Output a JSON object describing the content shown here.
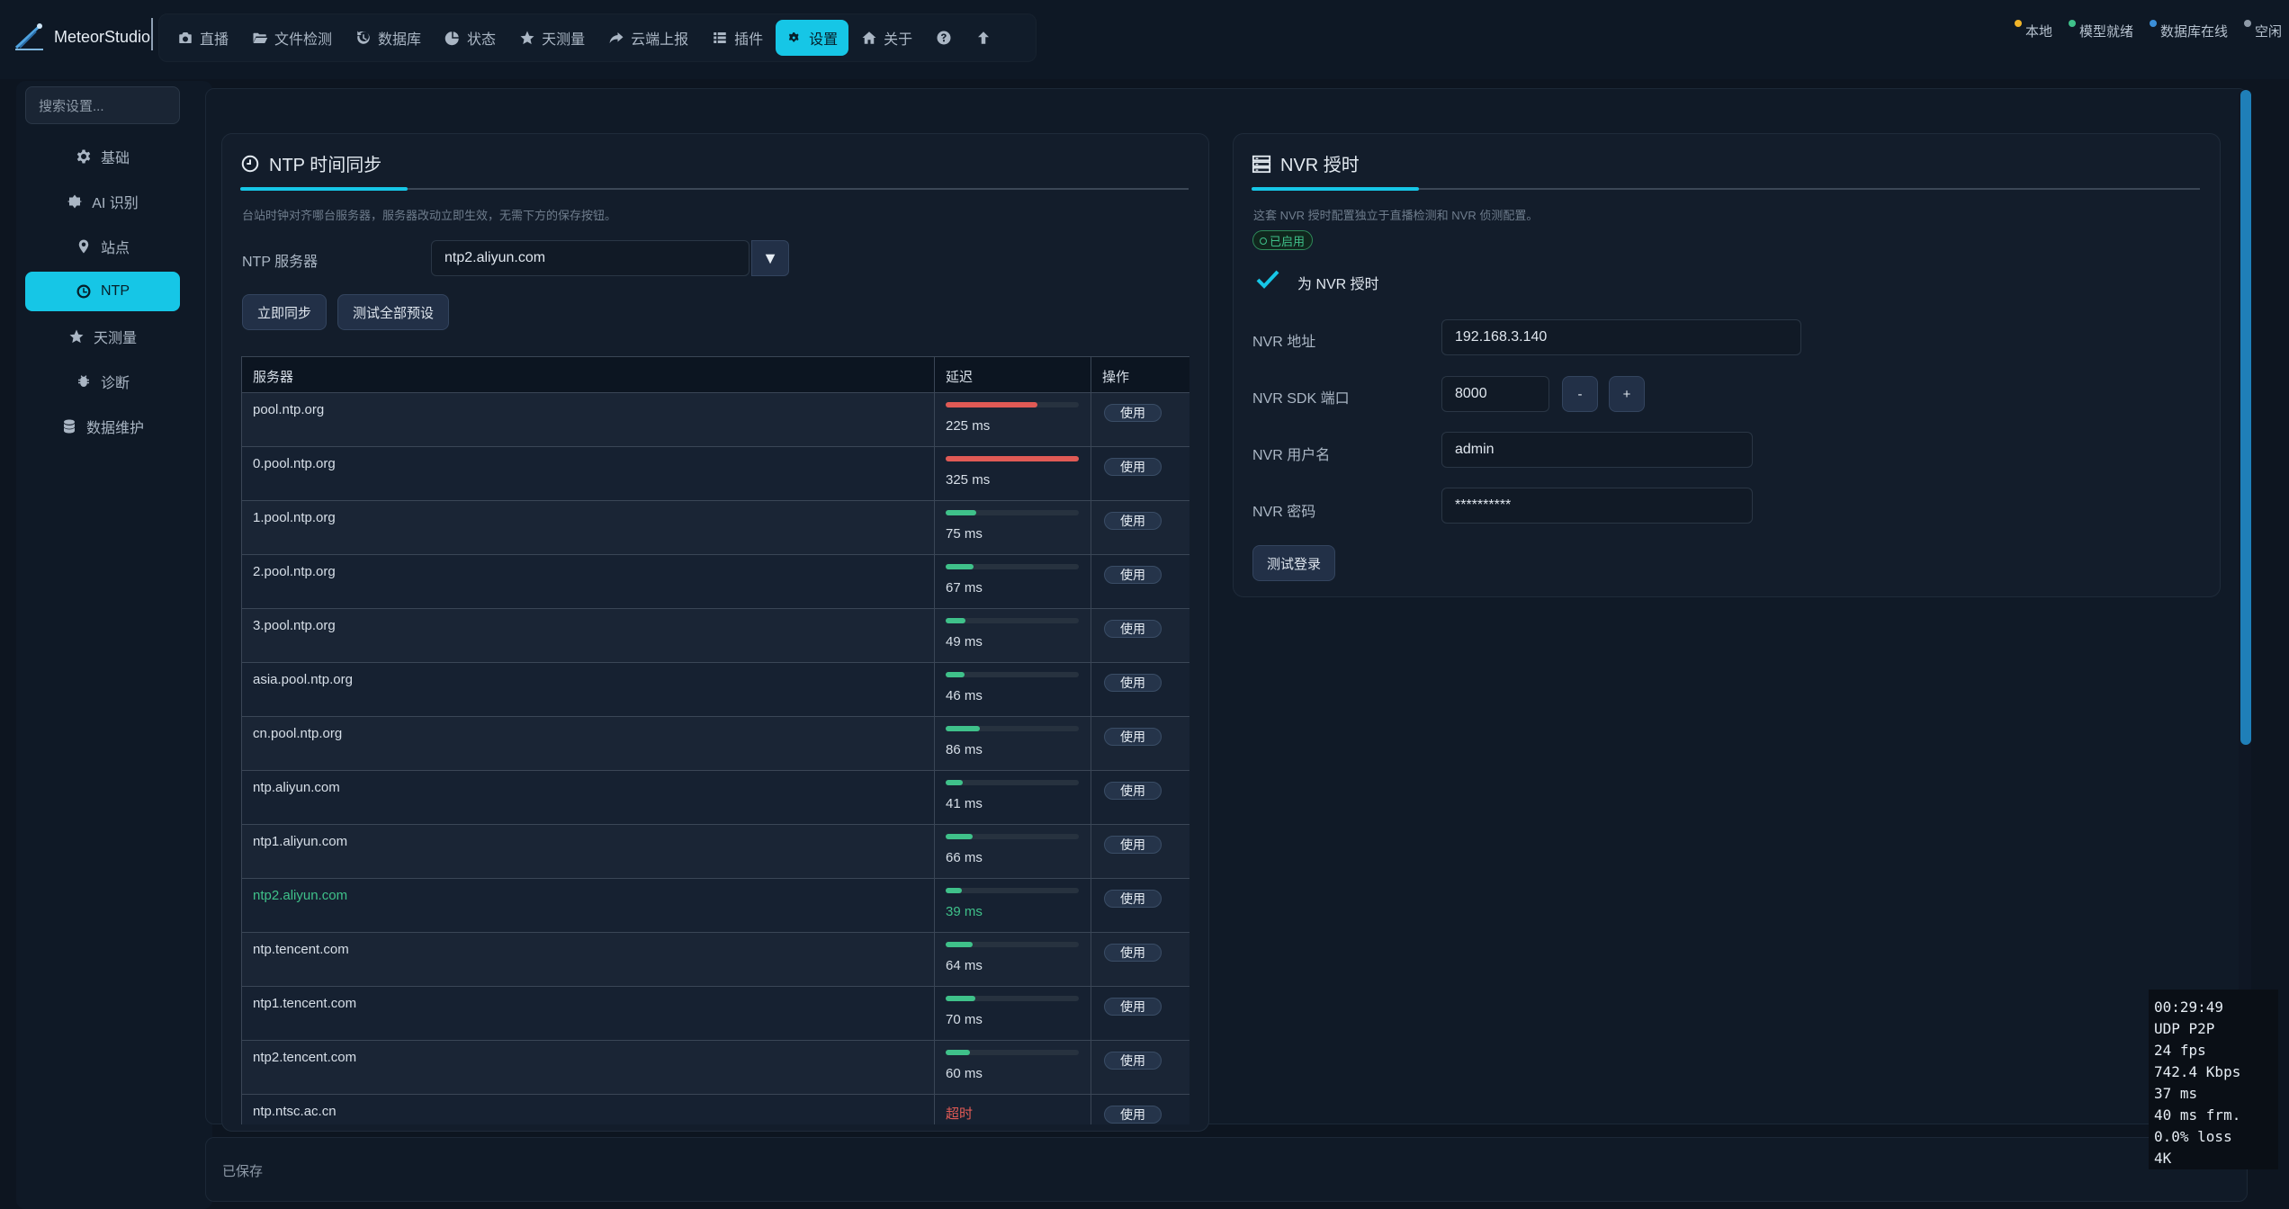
{
  "app": {
    "name": "MeteorStudio"
  },
  "nav": {
    "items": [
      {
        "label": "直播",
        "icon": "camera-icon"
      },
      {
        "label": "文件检测",
        "icon": "folder-open-icon"
      },
      {
        "label": "数据库",
        "icon": "history-icon"
      },
      {
        "label": "状态",
        "icon": "pie-chart-icon"
      },
      {
        "label": "天测量",
        "icon": "star-icon"
      },
      {
        "label": "云端上报",
        "icon": "share-arrow-icon"
      },
      {
        "label": "插件",
        "icon": "list-icon"
      },
      {
        "label": "设置",
        "icon": "gears-icon",
        "active": true
      },
      {
        "label": "关于",
        "icon": "home-icon"
      }
    ],
    "help_icon": "question-circle-icon",
    "upload_icon": "arrow-up-icon"
  },
  "status": [
    {
      "label": "本地",
      "color": "#f0b429"
    },
    {
      "label": "模型就绪",
      "color": "#3fc18a"
    },
    {
      "label": "数据库在线",
      "color": "#3b8fd9"
    },
    {
      "label": "空闲",
      "color": "#8e9aa8"
    }
  ],
  "sidebar": {
    "search_placeholder": "搜索设置...",
    "items": [
      {
        "label": "基础",
        "icon": "gear-icon"
      },
      {
        "label": "AI 识别",
        "icon": "brain-icon"
      },
      {
        "label": "站点",
        "icon": "map-pin-icon"
      },
      {
        "label": "NTP",
        "icon": "clock-icon",
        "active": true
      },
      {
        "label": "天测量",
        "icon": "star-icon"
      },
      {
        "label": "诊断",
        "icon": "bug-icon"
      },
      {
        "label": "数据维护",
        "icon": "database-icon"
      }
    ]
  },
  "ntp": {
    "title": "NTP 时间同步",
    "hint": "台站时钟对齐哪台服务器，服务器改动立即生效，无需下方的保存按钮。",
    "server_label": "NTP 服务器",
    "server_value": "ntp2.aliyun.com",
    "sync_button": "立即同步",
    "test_all_button": "测试全部预设",
    "columns": [
      "服务器",
      "延迟",
      "操作"
    ],
    "use_label": "使用",
    "rows": [
      {
        "server": "pool.ntp.org",
        "latency": "225 ms",
        "level": 0.69,
        "color": "#e05a55"
      },
      {
        "server": "0.pool.ntp.org",
        "latency": "325 ms",
        "level": 1.0,
        "color": "#e05a55"
      },
      {
        "server": "1.pool.ntp.org",
        "latency": "75 ms",
        "level": 0.23,
        "color": "#3fc18a"
      },
      {
        "server": "2.pool.ntp.org",
        "latency": "67 ms",
        "level": 0.21,
        "color": "#3fc18a"
      },
      {
        "server": "3.pool.ntp.org",
        "latency": "49 ms",
        "level": 0.15,
        "color": "#3fc18a"
      },
      {
        "server": "asia.pool.ntp.org",
        "latency": "46 ms",
        "level": 0.14,
        "color": "#3fc18a"
      },
      {
        "server": "cn.pool.ntp.org",
        "latency": "86 ms",
        "level": 0.26,
        "color": "#3fc18a"
      },
      {
        "server": "ntp.aliyun.com",
        "latency": "41 ms",
        "level": 0.13,
        "color": "#3fc18a"
      },
      {
        "server": "ntp1.aliyun.com",
        "latency": "66 ms",
        "level": 0.2,
        "color": "#3fc18a"
      },
      {
        "server": "ntp2.aliyun.com",
        "latency": "39 ms",
        "level": 0.12,
        "color": "#3fc18a",
        "selected": true
      },
      {
        "server": "ntp.tencent.com",
        "latency": "64 ms",
        "level": 0.2,
        "color": "#3fc18a"
      },
      {
        "server": "ntp1.tencent.com",
        "latency": "70 ms",
        "level": 0.22,
        "color": "#3fc18a"
      },
      {
        "server": "ntp2.tencent.com",
        "latency": "60 ms",
        "level": 0.18,
        "color": "#3fc18a"
      },
      {
        "server": "ntp.ntsc.ac.cn",
        "latency": "超时",
        "timeout": true
      }
    ]
  },
  "nvr": {
    "title": "NVR 授时",
    "hint": "这套 NVR 授时配置独立于直播检测和 NVR 侦测配置。",
    "badge": "已启用",
    "enable_label": "为 NVR 授时",
    "address_label": "NVR 地址",
    "address_value": "192.168.3.140",
    "port_label": "NVR SDK 端口",
    "port_value": "8000",
    "minus_label": "-",
    "plus_label": "+",
    "user_label": "NVR 用户名",
    "user_value": "admin",
    "password_label": "NVR 密码",
    "password_value": "**********",
    "test_button": "测试登录"
  },
  "footer": {
    "status": "已保存"
  },
  "stream_stats": [
    "00:29:49",
    "UDP P2P",
    "24 fps",
    "742.4 Kbps",
    "37 ms",
    "40 ms frm.",
    "0.0% loss",
    "4K"
  ]
}
